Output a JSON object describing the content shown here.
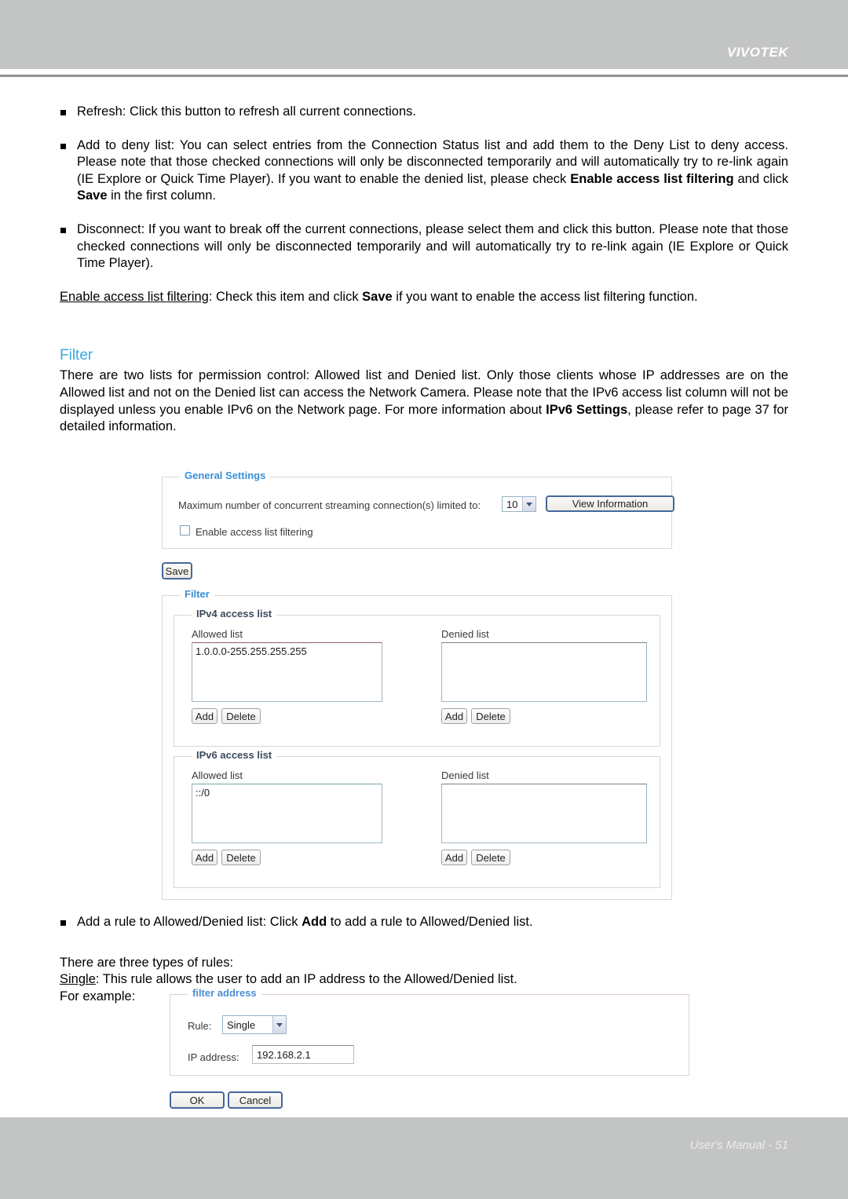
{
  "header": {
    "brand": "VIVOTEK"
  },
  "footer": {
    "manual_label": "User's Manual - 51"
  },
  "body_text": {
    "refresh_bullet": "Refresh: Click this button to refresh all current connections.",
    "add_deny_bullet_p1": "Add to deny list: You can select entries from the Connection Status list and add them to the Deny List to deny access. Please note that those checked connections will only be disconnected temporarily and will automatically try to re-link again (IE Explore or Quick Time Player). If you want to enable the denied list, please check ",
    "add_deny_bold1": "Enable access list filtering",
    "add_deny_mid": " and click ",
    "add_deny_bold2": "Save",
    "add_deny_end": " in the first column.",
    "disconnect_bullet": "Disconnect: If you want to break off the current connections, please select them and click this button. Please note that those checked connections will only be disconnected temporarily and will automatically try to re-link again (IE Explore or Quick Time Player).",
    "enable_filter_underline": "Enable access list filtering",
    "enable_filter_p1": ": Check this item and click ",
    "enable_filter_bold": "Save",
    "enable_filter_p2": " if you want to enable the access list filtering function.",
    "filter_heading": "Filter",
    "filter_para_p1": "There are two lists for permission control: Allowed list and Denied list. Only those clients whose IP addresses are on the Allowed list and not on the Denied list can access the Network Camera. Please note that the IPv6 access list column will not be displayed unless you enable IPv6 on the Network page. For more information about ",
    "filter_para_bold": "IPv6 Settings",
    "filter_para_p2": ", please refer to page 37 for detailed information.",
    "add_rule_bullet_p1": "Add a rule to Allowed/Denied list: Click ",
    "add_rule_bold": "Add",
    "add_rule_p2": " to add a rule to Allowed/Denied list.",
    "three_types": "There are three types of rules:",
    "single_underline": "Single",
    "single_rest": ": This rule allows the user to add an IP address to the Allowed/Denied list.",
    "for_example": "For example:"
  },
  "general_settings": {
    "legend": "General Settings",
    "max_conn_label": "Maximum number of concurrent streaming connection(s) limited to:",
    "max_conn_value": "10",
    "view_information_button": "View Information",
    "enable_filtering_label": "Enable access list filtering",
    "enable_filtering_checked": false,
    "save_button": "Save"
  },
  "filter_panel": {
    "legend": "Filter",
    "ipv4": {
      "legend": "IPv4 access list",
      "allowed_label": "Allowed list",
      "allowed_value": "1.0.0.0-255.255.255.255",
      "denied_label": "Denied list",
      "denied_value": "",
      "add_button": "Add",
      "delete_button": "Delete"
    },
    "ipv6": {
      "legend": "IPv6 access list",
      "allowed_label": "Allowed list",
      "allowed_value": "::/0",
      "denied_label": "Denied list",
      "denied_value": "",
      "add_button": "Add",
      "delete_button": "Delete"
    }
  },
  "filter_address": {
    "legend": "filter address",
    "rule_label": "Rule:",
    "rule_value": "Single",
    "ip_label": "IP address:",
    "ip_value": "192.168.2.1",
    "ok_button": "OK",
    "cancel_button": "Cancel"
  },
  "colors": {
    "header_gray": "#c3c4c4",
    "heading_blue": "#36a9e1",
    "legend_blue": "#3b8fd4"
  }
}
